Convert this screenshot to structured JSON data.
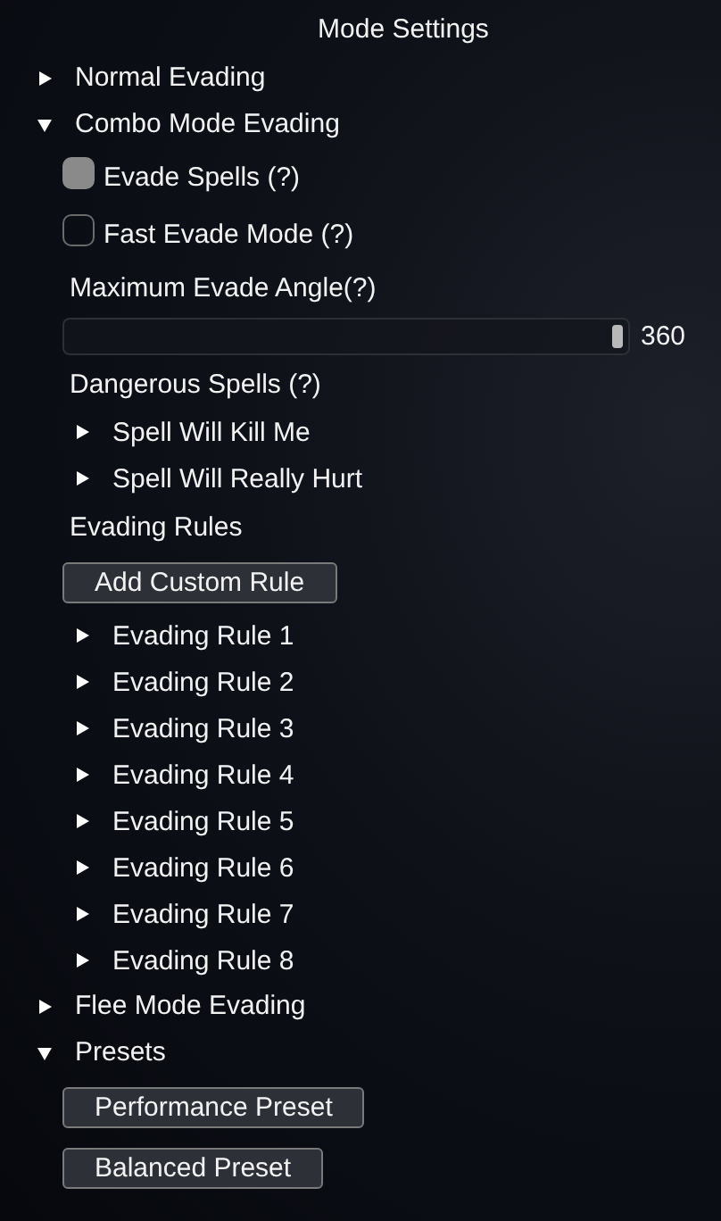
{
  "title": "Mode Settings",
  "sections": [
    {
      "label": "Normal Evading",
      "expanded": false
    },
    {
      "label": "Combo Mode Evading",
      "expanded": true,
      "items": [
        {
          "kind": "checkbox",
          "label": "Evade Spells (?)",
          "checked": true
        },
        {
          "kind": "checkbox",
          "label": "Fast Evade Mode (?)",
          "checked": false
        },
        {
          "kind": "slider",
          "label": "Maximum Evade Angle(?)",
          "level": 1,
          "reading": "360"
        },
        {
          "kind": "heading",
          "label": "Dangerous Spells (?)"
        },
        {
          "kind": "node",
          "label": "Spell Will Kill Me",
          "expanded": false
        },
        {
          "kind": "node",
          "label": "Spell Will Really Hurt",
          "expanded": false
        },
        {
          "kind": "heading",
          "label": "Evading Rules"
        },
        {
          "kind": "button",
          "label": "Add Custom Rule"
        },
        {
          "kind": "node",
          "label": "Evading Rule 1",
          "expanded": false
        },
        {
          "kind": "node",
          "label": "Evading Rule 2",
          "expanded": false
        },
        {
          "kind": "node",
          "label": "Evading Rule 3",
          "expanded": false
        },
        {
          "kind": "node",
          "label": "Evading Rule 4",
          "expanded": false
        },
        {
          "kind": "node",
          "label": "Evading Rule 5",
          "expanded": false
        },
        {
          "kind": "node",
          "label": "Evading Rule 6",
          "expanded": false
        },
        {
          "kind": "node",
          "label": "Evading Rule 7",
          "expanded": false
        },
        {
          "kind": "node",
          "label": "Evading Rule 8",
          "expanded": false
        }
      ]
    },
    {
      "label": "Flee Mode Evading",
      "expanded": false
    },
    {
      "label": "Presets",
      "expanded": true,
      "items": [
        {
          "kind": "button",
          "label": "Performance Preset"
        },
        {
          "kind": "button",
          "label": "Balanced Preset"
        }
      ]
    }
  ]
}
